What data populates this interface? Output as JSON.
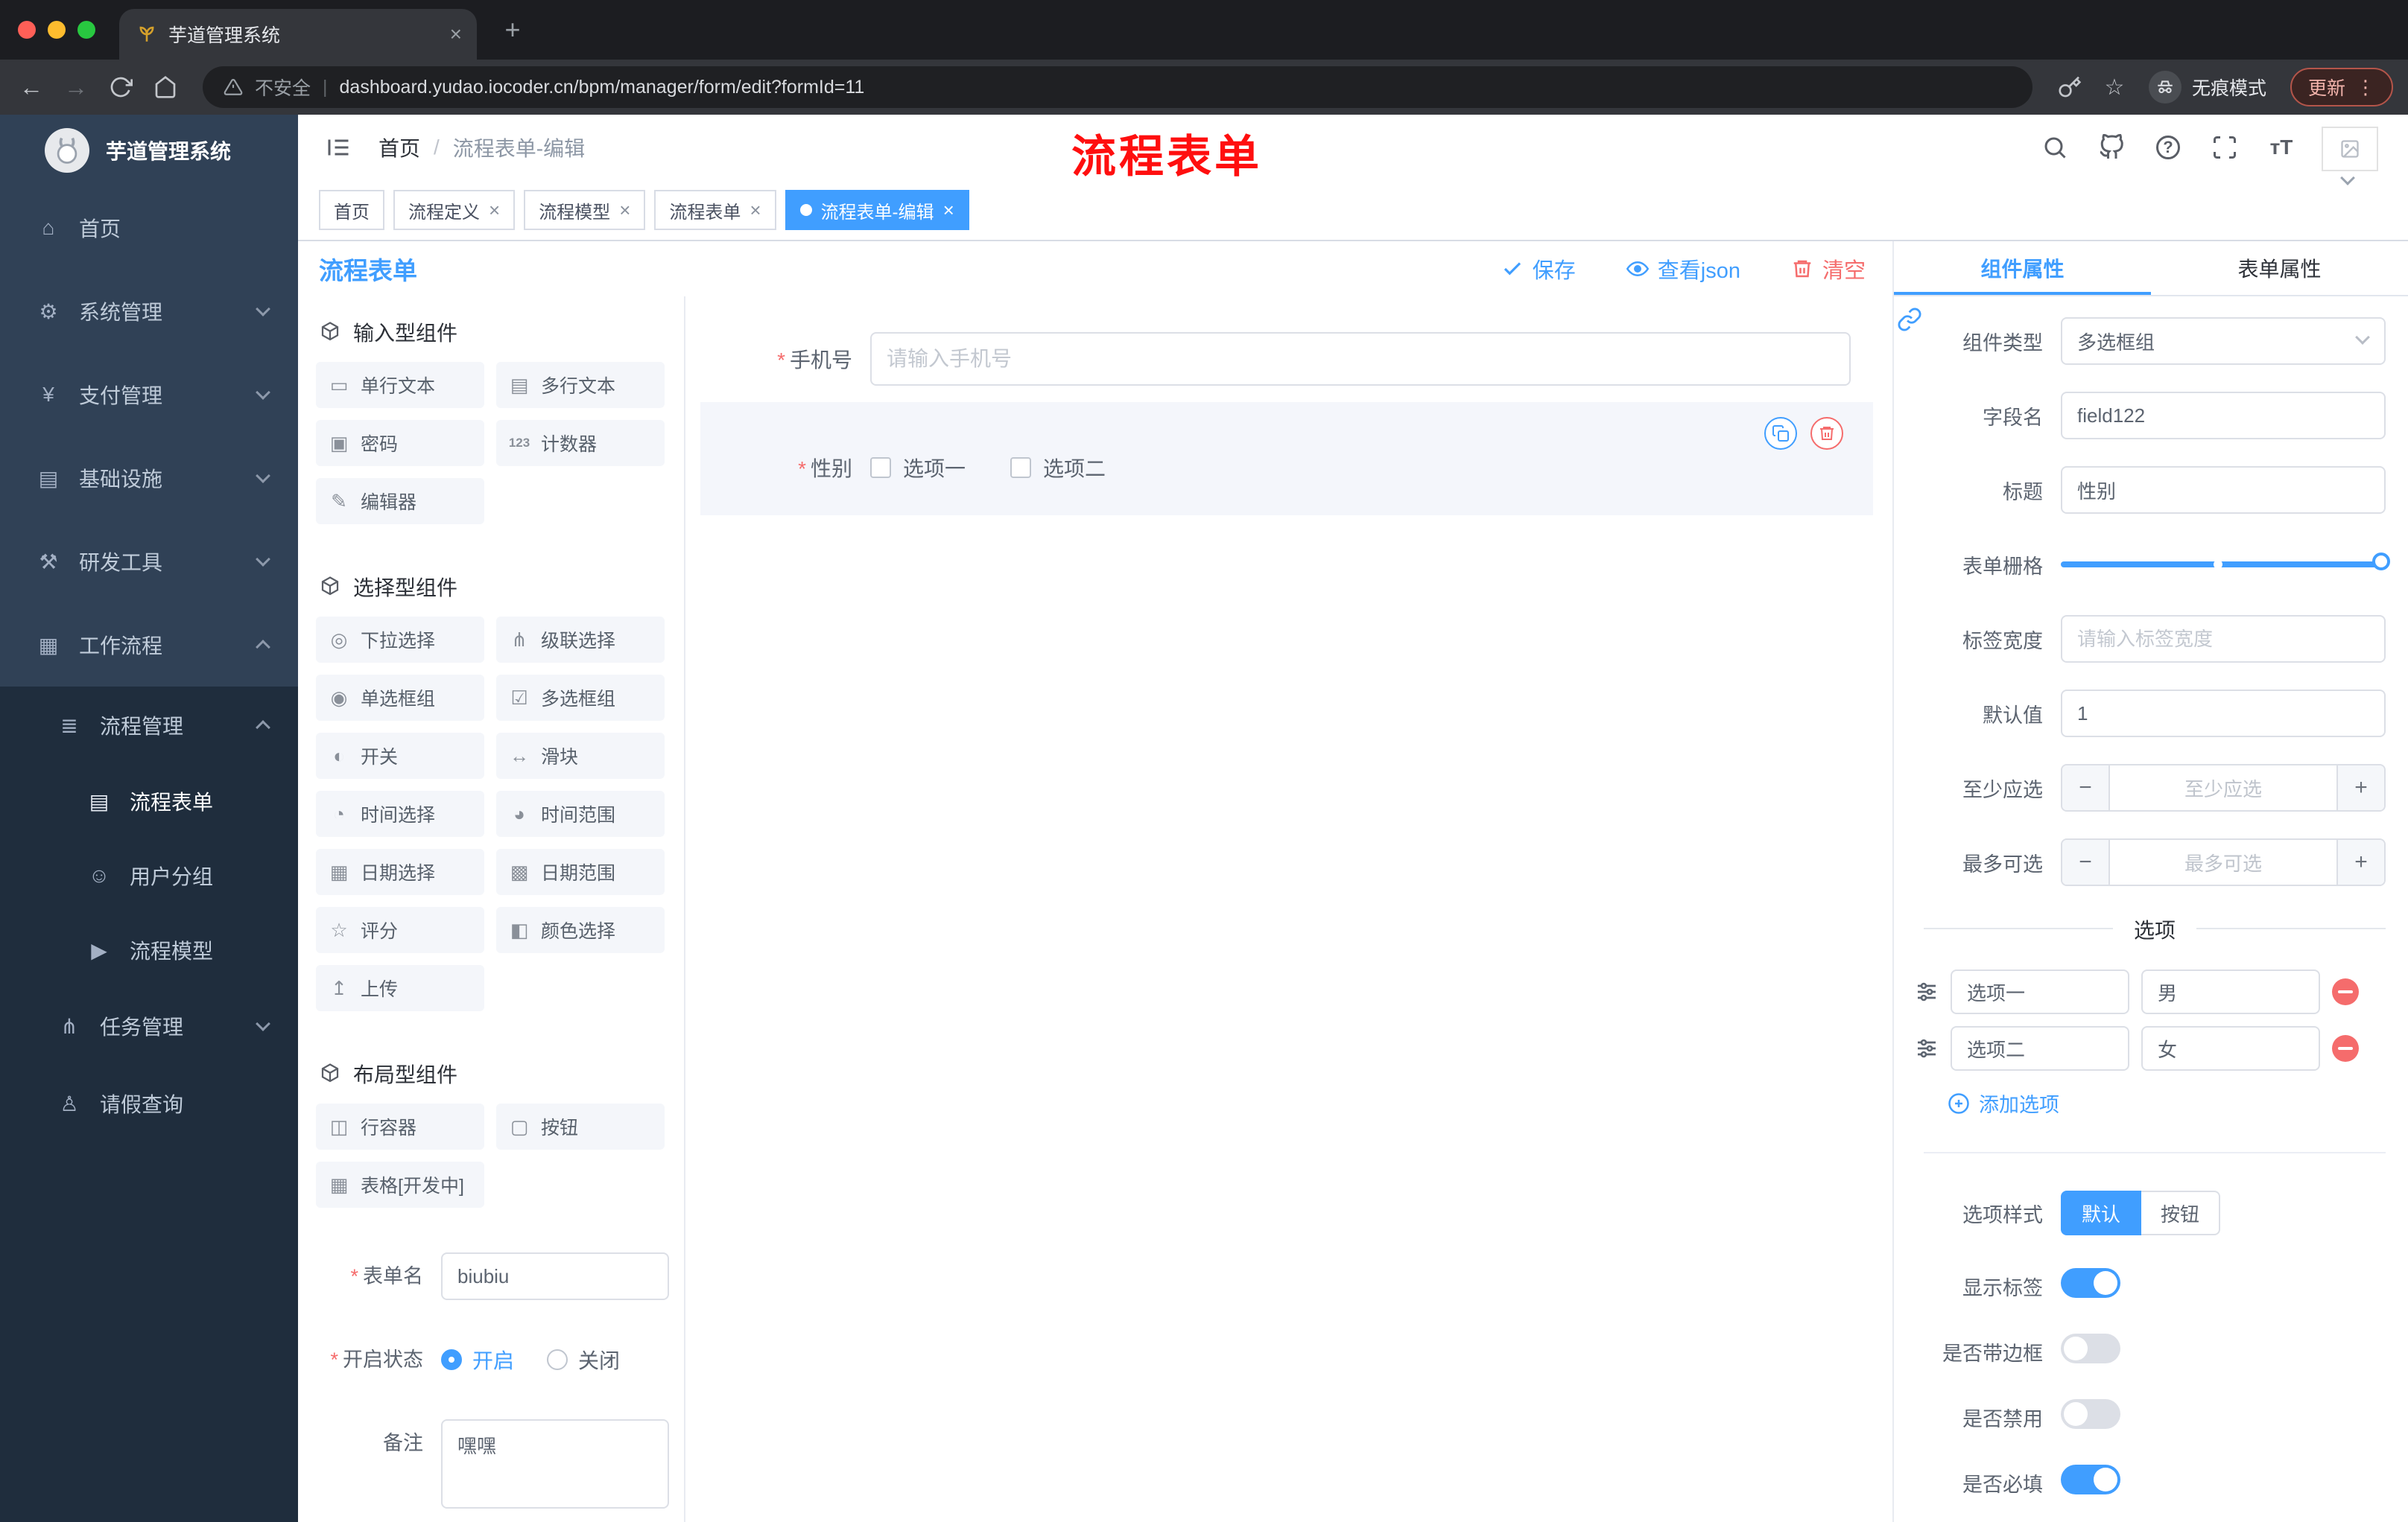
{
  "misc": {
    "required_mark": "*",
    "breadcrumb_separator": "/",
    "url_separator": "|"
  },
  "colors": {
    "accent": "#409eff",
    "danger": "#f56c6c",
    "annotation": "#ff0000",
    "sidebar": "#304156",
    "submenu": "#1f2d3d"
  },
  "icons": {
    "back": "←",
    "forward": "→",
    "star": "☆",
    "menu_dots": "⋮",
    "close": "×",
    "plus": "+",
    "minus": "−",
    "help": "?",
    "font_size": "ᴛT",
    "menu_home": "⌂",
    "menu_system": "⚙",
    "menu_pay": "¥",
    "menu_infra": "▤",
    "menu_dev": "⚒",
    "menu_flow": "▦",
    "menu_flow_mgr": "≣",
    "menu_form": "▤",
    "menu_group": "☺",
    "menu_model": "▶",
    "menu_task": "⋔",
    "menu_leave": "♙",
    "chip_single": "▭",
    "chip_multi": "▤",
    "chip_password": "▣",
    "chip_counter": "123",
    "chip_editor": "✎",
    "chip_select": "◎",
    "chip_cascader": "⋔",
    "chip_radio": "◉",
    "chip_checkbox": "☑",
    "chip_switch": "◐",
    "chip_slider": "↔",
    "chip_time": "◔",
    "chip_timerange": "◕",
    "chip_date": "▦",
    "chip_daterange": "▩",
    "chip_rate": "☆",
    "chip_color": "◧",
    "chip_upload": "↥",
    "chip_row": "◫",
    "chip_button": "▢",
    "chip_table": "▦"
  },
  "browser": {
    "tab_title": "芋道管理系统",
    "security_label": "不安全",
    "url": "dashboard.yudao.iocoder.cn/bpm/manager/form/edit?formId=11",
    "incognito_label": "无痕模式",
    "update_label": "更新"
  },
  "sidebar": {
    "logo_title": "芋道管理系统",
    "menu": [
      {
        "label": "首页"
      },
      {
        "label": "系统管理"
      },
      {
        "label": "支付管理"
      },
      {
        "label": "基础设施"
      },
      {
        "label": "研发工具"
      },
      {
        "label": "工作流程"
      },
      {
        "label": "流程管理"
      },
      {
        "label": "流程表单"
      },
      {
        "label": "用户分组"
      },
      {
        "label": "流程模型"
      },
      {
        "label": "任务管理"
      },
      {
        "label": "请假查询"
      }
    ]
  },
  "header": {
    "breadcrumb": [
      "首页",
      "流程表单-编辑"
    ],
    "annotation": "流程表单"
  },
  "tags": [
    {
      "label": "首页"
    },
    {
      "label": "流程定义"
    },
    {
      "label": "流程模型"
    },
    {
      "label": "流程表单"
    },
    {
      "label": "流程表单-编辑"
    }
  ],
  "designer": {
    "title": "流程表单",
    "actions": {
      "save": "保存",
      "view_json": "查看json",
      "clear": "清空"
    },
    "palette": {
      "groups": [
        {
          "title": "输入型组件",
          "items": [
            "单行文本",
            "多行文本",
            "密码",
            "计数器",
            "编辑器"
          ]
        },
        {
          "title": "选择型组件",
          "items": [
            "下拉选择",
            "级联选择",
            "单选框组",
            "多选框组",
            "开关",
            "滑块",
            "时间选择",
            "时间范围",
            "日期选择",
            "日期范围",
            "评分",
            "颜色选择",
            "上传"
          ]
        },
        {
          "title": "布局型组件",
          "items": [
            "行容器",
            "按钮",
            "表格[开发中]"
          ]
        }
      ]
    },
    "meta": {
      "name_label": "表单名",
      "name_value": "biubiu",
      "status_label": "开启状态",
      "status_on": "开启",
      "status_off": "关闭",
      "remark_label": "备注",
      "remark_value": "嘿嘿"
    },
    "canvas": {
      "phone": {
        "label": "手机号",
        "placeholder": "请输入手机号"
      },
      "gender": {
        "label": "性别",
        "option1": "选项一",
        "option2": "选项二"
      }
    }
  },
  "props": {
    "tab_component": "组件属性",
    "tab_form": "表单属性",
    "component_type_label": "组件类型",
    "component_type_value": "多选框组",
    "field_label": "字段名",
    "field_value": "field122",
    "title_label": "标题",
    "title_value": "性别",
    "grid_label": "表单栅格",
    "label_width_label": "标签宽度",
    "label_width_placeholder": "请输入标签宽度",
    "default_label": "默认值",
    "default_value": "1",
    "min_label": "至少应选",
    "min_placeholder": "至少应选",
    "max_label": "最多可选",
    "max_placeholder": "最多可选",
    "options_title": "选项",
    "options": [
      {
        "name": "选项一",
        "value": "男"
      },
      {
        "name": "选项二",
        "value": "女"
      }
    ],
    "add_option": "添加选项",
    "style_label": "选项样式",
    "style_default": "默认",
    "style_button": "按钮",
    "switch_show_label": "显示标签",
    "switch_border": "是否带边框",
    "switch_disabled": "是否禁用",
    "switch_required": "是否必填"
  }
}
